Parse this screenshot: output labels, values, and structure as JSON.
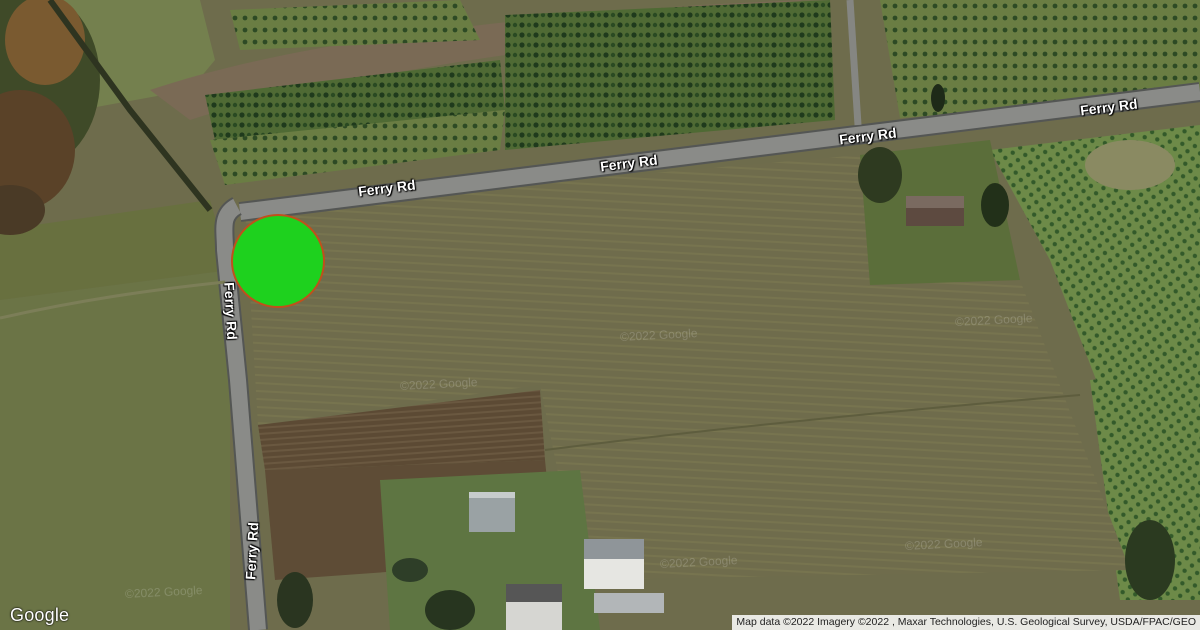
{
  "map": {
    "type": "satellite",
    "road_labels": [
      "Ferry Rd",
      "Ferry Rd",
      "Ferry Rd",
      "Ferry Rd",
      "Ferry Rd",
      "Ferry Rd"
    ],
    "watermark": "©2022 Google",
    "marker": {
      "color": "#1ed11e",
      "border_color": "#c0501c"
    }
  },
  "branding": {
    "logo": "Google"
  },
  "attribution": "Map data ©2022 Imagery ©2022 , Maxar Technologies, U.S. Geological Survey, USDA/FPAC/GEO"
}
